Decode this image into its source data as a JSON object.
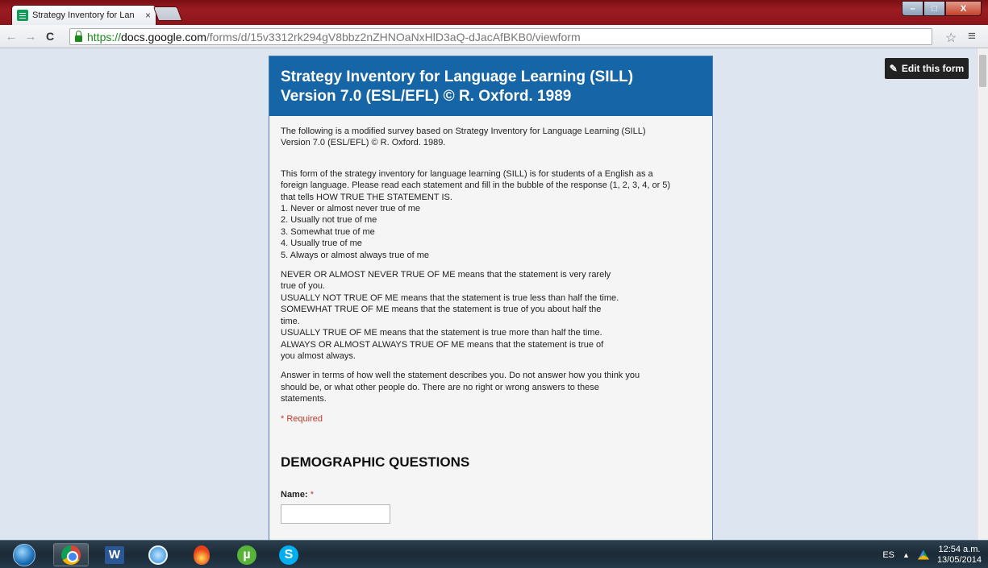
{
  "browser": {
    "tab_title": "Strategy Inventory for Lan",
    "tab_close": "×",
    "url_scheme": "https://",
    "url_host": "docs.google.com",
    "url_path": "/forms/d/15v3312rk294gV8bbz2nZHNOaNxHlD3aQ-dJacAfBKB0/viewform"
  },
  "form": {
    "title_line1": "Strategy Inventory for Language Learning (SILL)",
    "title_line2": "Version 7.0 (ESL/EFL) © R. Oxford. 1989",
    "intro": "The following is a modified survey based on Strategy Inventory for Language Learning (SILL)\nVersion 7.0 (ESL/EFL) © R. Oxford. 1989.",
    "instructions": "This form of the strategy inventory for language learning (SILL) is for students of a English as a\nforeign language. Please read each statement and fill in the bubble of the response (1, 2, 3, 4, or 5)\nthat tells HOW TRUE THE STATEMENT IS.\n1. Never or almost never true of me\n2. Usually not true of me\n3. Somewhat true of me\n4. Usually true of me\n5. Always or almost always true of me",
    "definitions": "NEVER OR ALMOST NEVER TRUE OF ME means that the statement is very rarely\ntrue of you.\nUSUALLY NOT TRUE OF ME means that the statement is true less than half the time.\nSOMEWHAT TRUE OF ME means that the statement is true of you about half the\ntime.\nUSUALLY TRUE OF ME means that the statement is true more than half the time.\nALWAYS OR ALMOST ALWAYS TRUE OF ME means that the statement is true of\nyou almost always.",
    "answer_note": "Answer in terms of how well the statement describes you. Do not answer how you think you\nshould be, or what other people do. There are no right or wrong answers to these\nstatements.",
    "required_note": "* Required",
    "section_title": "DEMOGRAPHIC QUESTIONS",
    "name_label": "Name:",
    "name_required": "*",
    "name_value": ""
  },
  "edit_button": {
    "label": "Edit this form"
  },
  "taskbar": {
    "language": "ES",
    "time": "12:54 a.m.",
    "date": "13/05/2014",
    "word_letter": "W",
    "torrent_letter": "µ",
    "skype_letter": "S"
  },
  "icons": {
    "back": "back-arrow-icon",
    "forward": "forward-arrow-icon",
    "reload": "reload-icon",
    "lock": "lock-icon",
    "star": "bookmark-star-icon",
    "menu": "menu-icon",
    "pencil": "pencil-icon"
  },
  "colors": {
    "form_header": "#1565a7",
    "required": "#c0392b",
    "page_background": "#dde6f0",
    "secure_url": "#1b8a1b"
  }
}
